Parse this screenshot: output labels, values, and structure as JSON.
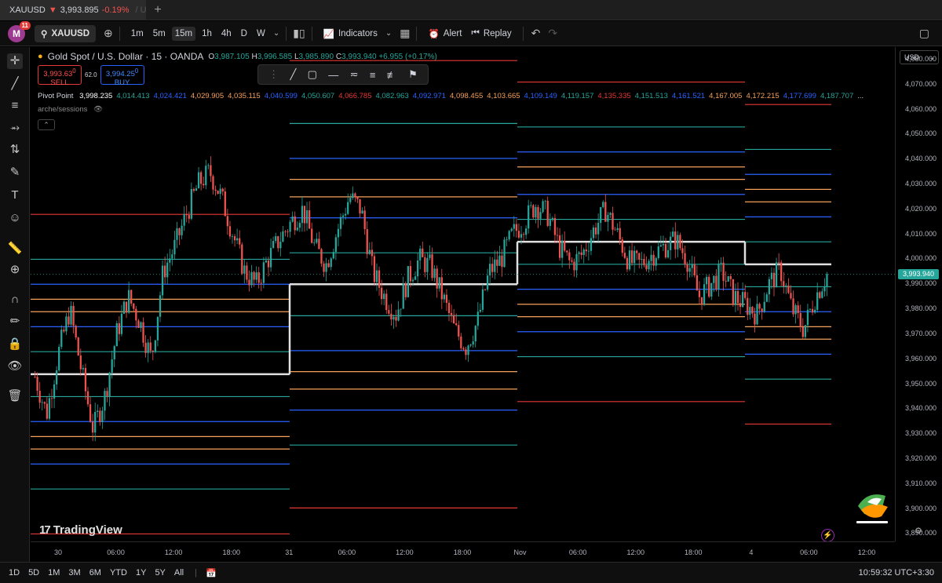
{
  "browser_tab": {
    "title": "XAUUSD",
    "arrow": "▼",
    "price": "3,993.895",
    "change": "-0.19%",
    "trail": "/ U"
  },
  "toolbar": {
    "avatar_letter": "M",
    "avatar_badge": "11",
    "symbol": "XAUUSD",
    "timeframes": [
      "1m",
      "5m",
      "15m",
      "1h",
      "4h",
      "D",
      "W"
    ],
    "active_timeframe": "15m",
    "indicators_label": "Indicators",
    "alert_label": "Alert",
    "replay_label": "Replay"
  },
  "legend": {
    "title": "Gold Spot / U.S. Dollar · 15 · OANDA",
    "open_k": "O",
    "open": "3,987.105",
    "high_k": "H",
    "high": "3,996.585",
    "low_k": "L",
    "low": "3,985.890",
    "close_k": "C",
    "close": "3,993.940",
    "change": "+6.955 (+0.17%)"
  },
  "trade": {
    "sell_price": "3,993.63",
    "sell_sup": "0",
    "sell_label": "SELL",
    "spread": "62.0",
    "buy_price": "3,994.25",
    "buy_sup": "0",
    "buy_label": "BUY"
  },
  "pivot": {
    "label": "Pivot Point",
    "values": [
      {
        "v": "3,998.235",
        "c": "#ffffff"
      },
      {
        "v": "4,014.413",
        "c": "#26a69a"
      },
      {
        "v": "4,024.421",
        "c": "#2962ff"
      },
      {
        "v": "4,029.905",
        "c": "#f5a05a"
      },
      {
        "v": "4,035.115",
        "c": "#f5a05a"
      },
      {
        "v": "4,040.599",
        "c": "#2962ff"
      },
      {
        "v": "4,050.607",
        "c": "#26a69a"
      },
      {
        "v": "4,066.785",
        "c": "#e53935"
      },
      {
        "v": "4,082.963",
        "c": "#26a69a"
      },
      {
        "v": "4,092.971",
        "c": "#2962ff"
      },
      {
        "v": "4,098.455",
        "c": "#f5a05a"
      },
      {
        "v": "4,103.665",
        "c": "#f5a05a"
      },
      {
        "v": "4,109.149",
        "c": "#2962ff"
      },
      {
        "v": "4,119.157",
        "c": "#26a69a"
      },
      {
        "v": "4,135.335",
        "c": "#e53935"
      },
      {
        "v": "4,151.513",
        "c": "#26a69a"
      },
      {
        "v": "4,161.521",
        "c": "#2962ff"
      },
      {
        "v": "4,167.005",
        "c": "#f5a05a"
      },
      {
        "v": "4,172.215",
        "c": "#f5a05a"
      },
      {
        "v": "4,177.699",
        "c": "#2962ff"
      },
      {
        "v": "4,187.707",
        "c": "#26a69a"
      }
    ],
    "more": "..."
  },
  "sessions_label": "arche/sessions",
  "price_axis": {
    "currency": "USD",
    "ticks": [
      "4,080.000",
      "4,070.000",
      "4,060.000",
      "4,050.000",
      "4,040.000",
      "4,030.000",
      "4,020.000",
      "4,010.000",
      "4,000.000",
      "3,990.000",
      "3,980.000",
      "3,970.000",
      "3,960.000",
      "3,950.000",
      "3,940.000",
      "3,930.000",
      "3,920.000",
      "3,910.000",
      "3,900.000",
      "3,890.000"
    ],
    "current_price": "3,993.940"
  },
  "time_axis": {
    "ticks": [
      {
        "label": "30"
      },
      {
        "label": "06:00"
      },
      {
        "label": "12:00"
      },
      {
        "label": "18:00"
      },
      {
        "label": "31"
      },
      {
        "label": "06:00"
      },
      {
        "label": "12:00"
      },
      {
        "label": "18:00"
      },
      {
        "label": "Nov"
      },
      {
        "label": "06:00"
      },
      {
        "label": "12:00"
      },
      {
        "label": "18:00"
      },
      {
        "label": "4"
      },
      {
        "label": "06:00"
      },
      {
        "label": "12:00"
      }
    ]
  },
  "bottom": {
    "ranges": [
      "1D",
      "5D",
      "1M",
      "3M",
      "6M",
      "YTD",
      "1Y",
      "5Y",
      "All"
    ],
    "clock": "10:59:32 UTC+3:30"
  },
  "watermark": {
    "logo": "17",
    "text": "TradingView"
  },
  "colors": {
    "up": "#26a69a",
    "down": "#ef5350",
    "pivot": "#e0e0e0",
    "r1": "#e53935",
    "support": "#2962ff",
    "mid": "#f5a05a"
  },
  "chart_data": {
    "type": "candlestick",
    "series_close_anchor": [
      3953,
      3938,
      3962,
      3980,
      3955,
      3932,
      3945,
      3970,
      3985,
      3975,
      3960,
      3995,
      4005,
      4018,
      4030,
      4035,
      4025,
      4010,
      3995,
      3990,
      4000,
      4008,
      4015,
      4020,
      4005,
      3998,
      4012,
      4025,
      4020,
      3995,
      3985,
      3978,
      3992,
      4000,
      3997,
      3985,
      3972,
      3965,
      3975,
      3995,
      4000,
      4010,
      4015,
      4022,
      4018,
      4005,
      3998,
      4002,
      4012,
      4020,
      4010,
      3999,
      3998,
      4002,
      4005,
      4008,
      4000,
      3985,
      3990,
      3995,
      3985,
      3982,
      3978,
      3990,
      3996,
      3980,
      3972,
      3985,
      3994
    ],
    "y_range": [
      3887,
      4085
    ],
    "pivot_levels": [
      {
        "day": "30",
        "P": 3954,
        "R1": 4018
      },
      {
        "day": "31",
        "P": 3990,
        "R1": 4085
      },
      {
        "day": "Nov",
        "P": 4007,
        "R1": 4046
      },
      {
        "day": "4",
        "P": 3998,
        "R1": 4067
      }
    ]
  }
}
